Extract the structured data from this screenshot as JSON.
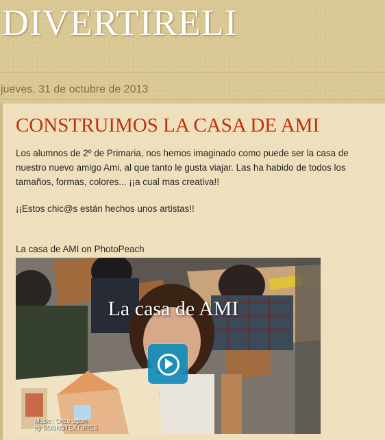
{
  "blog": {
    "title": "DIVERTIRELI"
  },
  "post": {
    "date": "jueves, 31 de octubre de 2013",
    "title": "CONSTRUIMOS LA CASA DE AMI",
    "paragraphs": [
      "Los alumnos de 2º de Primaria, nos hemos imaginado como puede ser la casa de nuestro nuevo amigo Ami, al que tanto le gusta viajar. Las ha habido de todos los tamaños, formas, colores... ¡¡a cual mas creativa!!",
      "¡¡Estos chic@s están hechos unos artistas!!"
    ],
    "embed_caption": "La casa de AMI on PhotoPeach"
  },
  "video": {
    "title": "La casa de AMI",
    "music_line1": "Music : Once again",
    "music_line2": "by SOUNDTEXTURES"
  },
  "colors": {
    "background": "#d9c794",
    "post_background": "#eedfbd",
    "title_red": "#c12e0d",
    "date_brown": "#8a6e3c",
    "play_blue": "#148cb9"
  }
}
